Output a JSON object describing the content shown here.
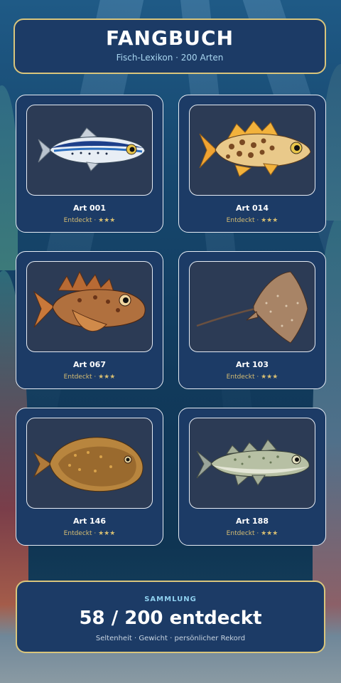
{
  "header": {
    "title": "FANGBUCH",
    "subtitle": "Fisch-Lexikon · 200 Arten"
  },
  "cards": [
    {
      "name": "Art 001",
      "status": "Entdeckt · ★★★",
      "icon": "sardine-icon"
    },
    {
      "name": "Art 014",
      "status": "Entdeckt · ★★★",
      "icon": "spotted-perch-icon"
    },
    {
      "name": "Art 067",
      "status": "Entdeckt · ★★★",
      "icon": "scorpionfish-icon"
    },
    {
      "name": "Art 103",
      "status": "Entdeckt · ★★★",
      "icon": "stingray-icon"
    },
    {
      "name": "Art 146",
      "status": "Entdeckt · ★★★",
      "icon": "flounder-icon"
    },
    {
      "name": "Art 188",
      "status": "Entdeckt · ★★★",
      "icon": "cod-icon"
    }
  ],
  "summary": {
    "label": "SAMMLUNG",
    "count": "58 / 200 entdeckt",
    "detail": "Seltenheit · Gewicht · persönlicher Rekord"
  },
  "colors": {
    "panel": "#1c3b66",
    "gold_border": "#d9c57c",
    "accent_text": "#d7be72",
    "frame": "#2c3b55"
  }
}
